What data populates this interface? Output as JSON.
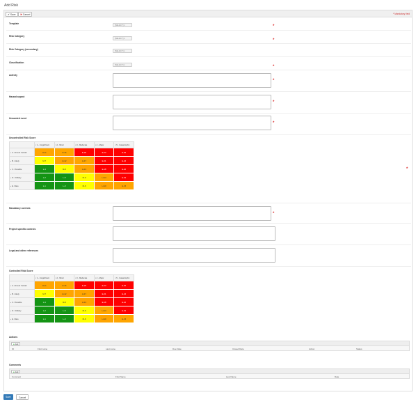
{
  "page_title": "Add Risk",
  "toolbar": {
    "save_label": "Save",
    "cancel_label": "Cancel",
    "mandatory_note": "* Mandatory field"
  },
  "fields": {
    "template": {
      "label": "Template",
      "value": "[SELECT]"
    },
    "risk_category": {
      "label": "Risk Category",
      "value": "[SELECT]"
    },
    "risk_category_secondary": {
      "label": "Risk Category (secondary)",
      "value": "[SELECT]"
    },
    "classification": {
      "label": "Classification",
      "value": "[SELECT]"
    },
    "activity": {
      "label": "Activity"
    },
    "hazard_aspect": {
      "label": "Hazard aspect"
    },
    "unwanted_event": {
      "label": "Unwanted event"
    },
    "mandatory_controls": {
      "label": "Mandatory controls"
    },
    "project_specific_controls": {
      "label": "Project specific controls"
    },
    "legal_other_references": {
      "label": "Legal and other references"
    }
  },
  "required_mark": "*",
  "matrix_columns": [
    "1 - Insignificant",
    "2 - Minor",
    "3 - Moderate",
    "4 - Major",
    "5 - Catastrophic"
  ],
  "uncontrolled": {
    "title": "Uncontrolled Risk Score",
    "rows": [
      {
        "label": "A. Almost Certain",
        "cells": [
          [
            "H-11",
            "orange"
          ],
          [
            "H-16",
            "orange"
          ],
          [
            "E-20",
            "red"
          ],
          [
            "E-23",
            "red"
          ],
          [
            "E-25",
            "red"
          ]
        ]
      },
      {
        "label": "B. Likely",
        "cells": [
          [
            "M-7",
            "yellow"
          ],
          [
            "H-12",
            "orange"
          ],
          [
            "H-17",
            "orange"
          ],
          [
            "E-21",
            "red"
          ],
          [
            "E-24",
            "red"
          ]
        ]
      },
      {
        "label": "C. Possible",
        "cells": [
          [
            "L-4",
            "green"
          ],
          [
            "M-8",
            "yellow"
          ],
          [
            "H-13",
            "orange"
          ],
          [
            "E-18",
            "red"
          ],
          [
            "E-22",
            "red"
          ]
        ]
      },
      {
        "label": "D. Unlikely",
        "cells": [
          [
            "L-2",
            "green"
          ],
          [
            "L-5",
            "green"
          ],
          [
            "M-9",
            "yellow"
          ],
          [
            "H-14",
            "orange"
          ],
          [
            "E-19",
            "red"
          ]
        ]
      },
      {
        "label": "E. Rare",
        "cells": [
          [
            "L-1",
            "green"
          ],
          [
            "L-3",
            "green"
          ],
          [
            "M-6",
            "yellow"
          ],
          [
            "H-10",
            "orange"
          ],
          [
            "H-15",
            "orange"
          ]
        ]
      }
    ]
  },
  "controlled": {
    "title": "Controlled Risk Score",
    "rows": [
      {
        "label": "A. Almost Certain",
        "cells": [
          [
            "H-11",
            "orange"
          ],
          [
            "H-16",
            "orange"
          ],
          [
            "E-20",
            "red"
          ],
          [
            "E-23",
            "red"
          ],
          [
            "E-25",
            "red"
          ]
        ]
      },
      {
        "label": "B. Likely",
        "cells": [
          [
            "M-7",
            "yellow"
          ],
          [
            "H-12",
            "orange"
          ],
          [
            "H-17",
            "orange"
          ],
          [
            "E-21",
            "red"
          ],
          [
            "E-24",
            "red"
          ]
        ]
      },
      {
        "label": "C. Possible",
        "cells": [
          [
            "L-4",
            "green"
          ],
          [
            "M-8",
            "yellow"
          ],
          [
            "H-13",
            "orange"
          ],
          [
            "E-18",
            "red"
          ],
          [
            "E-22",
            "red"
          ]
        ]
      },
      {
        "label": "D. Unlikely",
        "cells": [
          [
            "L-2",
            "green"
          ],
          [
            "L-5",
            "green"
          ],
          [
            "M-9",
            "yellow"
          ],
          [
            "H-14",
            "orange"
          ],
          [
            "E-19",
            "red"
          ]
        ]
      },
      {
        "label": "E. Rare",
        "cells": [
          [
            "L-1",
            "green"
          ],
          [
            "L-3",
            "green"
          ],
          [
            "M-6",
            "yellow"
          ],
          [
            "H-10",
            "orange"
          ],
          [
            "H-15",
            "orange"
          ]
        ]
      }
    ]
  },
  "actions": {
    "title": "Actions",
    "add_label": "Add",
    "columns": [
      "ID",
      "First name",
      "Last name",
      "Due Date",
      "Closed Date",
      "Action",
      "Status"
    ]
  },
  "comments": {
    "title": "Comments",
    "add_label": "Add",
    "columns": [
      "Comment",
      "First Name",
      "Last Name",
      "Date"
    ]
  },
  "footer": {
    "save_label": "Save",
    "cancel_label": "Cancel"
  },
  "colors": {
    "red": "#ff0000",
    "orange": "#ffa500",
    "yellow": "#ffff00",
    "green": "#149414",
    "primary": "#337ab7"
  }
}
